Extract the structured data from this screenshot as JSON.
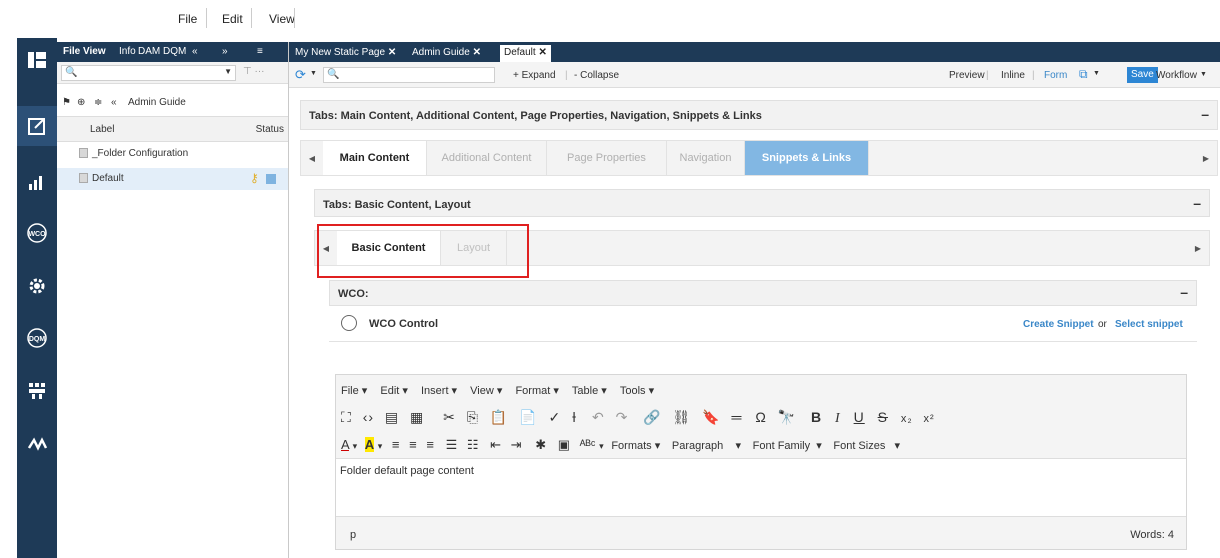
{
  "menubar": {
    "file": "File",
    "edit": "Edit",
    "view": "View"
  },
  "tree": {
    "tabs": [
      "File View",
      "Info",
      "DAM",
      "DQM"
    ],
    "breadcrumb": "Admin Guide",
    "header_label": "Label",
    "header_status": "Status",
    "rows": [
      "_Folder Configuration",
      "Default"
    ]
  },
  "doc_tabs": [
    "My New Static Page",
    "Admin Guide",
    "Default"
  ],
  "toolbar": {
    "expand": "+ Expand",
    "collapse": "- Collapse",
    "preview": "Preview",
    "inline": "Inline",
    "form": "Form",
    "save": "Save",
    "workflow": "Workflow"
  },
  "main": {
    "title": "Tabs: Main Content, Additional Content, Page Properties, Navigation, Snippets & Links",
    "tabs": [
      "Main Content",
      "Additional Content",
      "Page Properties",
      "Navigation",
      "Snippets & Links"
    ],
    "sub_title": "Tabs: Basic Content, Layout",
    "sub_tabs": [
      "Basic Content",
      "Layout"
    ],
    "wco_title": "WCO:",
    "wco_control": "WCO Control",
    "create_snippet": "Create Snippet",
    "or": "or",
    "select_snippet": "Select snippet"
  },
  "editor": {
    "menus": [
      "File",
      "Edit",
      "Insert",
      "View",
      "Format",
      "Table",
      "Tools"
    ],
    "formats": "Formats",
    "paragraph": "Paragraph",
    "font_family": "Font Family",
    "font_sizes": "Font Sizes",
    "content": "Folder default page content",
    "path": "p",
    "words": "Words: 4"
  }
}
